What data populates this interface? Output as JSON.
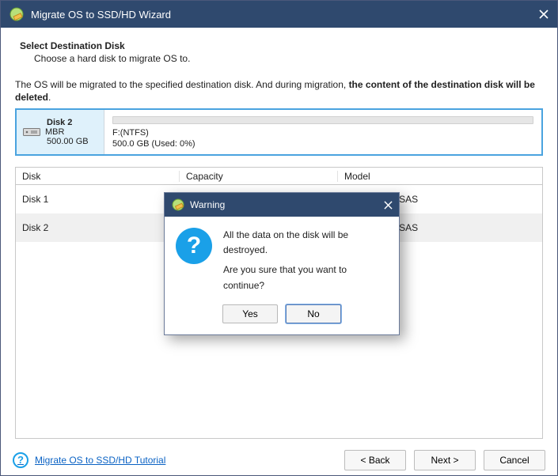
{
  "window": {
    "title": "Migrate OS to SSD/HD Wizard"
  },
  "page": {
    "heading": "Select Destination Disk",
    "subheading": "Choose a hard disk to migrate OS to.",
    "notice_pre": "The OS will be migrated to the specified destination disk. And during migration, ",
    "notice_bold": "the content of the destination disk will be deleted",
    "notice_post": "."
  },
  "selected_disk": {
    "name": "Disk 2",
    "scheme": "MBR",
    "size": "500.00 GB",
    "partition_label": "F:(NTFS)",
    "partition_usage": "500.0 GB (Used: 0%)"
  },
  "table": {
    "headers": {
      "disk": "Disk",
      "capacity": "Capacity",
      "model": "Model"
    },
    "rows": [
      {
        "disk": "Disk 1",
        "capacity": "",
        "model": "are Virtual S SAS"
      },
      {
        "disk": "Disk 2",
        "capacity": "",
        "model": "are Virtual S SAS"
      }
    ]
  },
  "footer": {
    "help_link": "Migrate OS to SSD/HD Tutorial",
    "back": "<  Back",
    "next": "Next  >",
    "cancel": "Cancel"
  },
  "dialog": {
    "title": "Warning",
    "line1": "All the data on the disk will be destroyed.",
    "line2": "Are you sure that you want to continue?",
    "yes": "Yes",
    "no": "No"
  }
}
